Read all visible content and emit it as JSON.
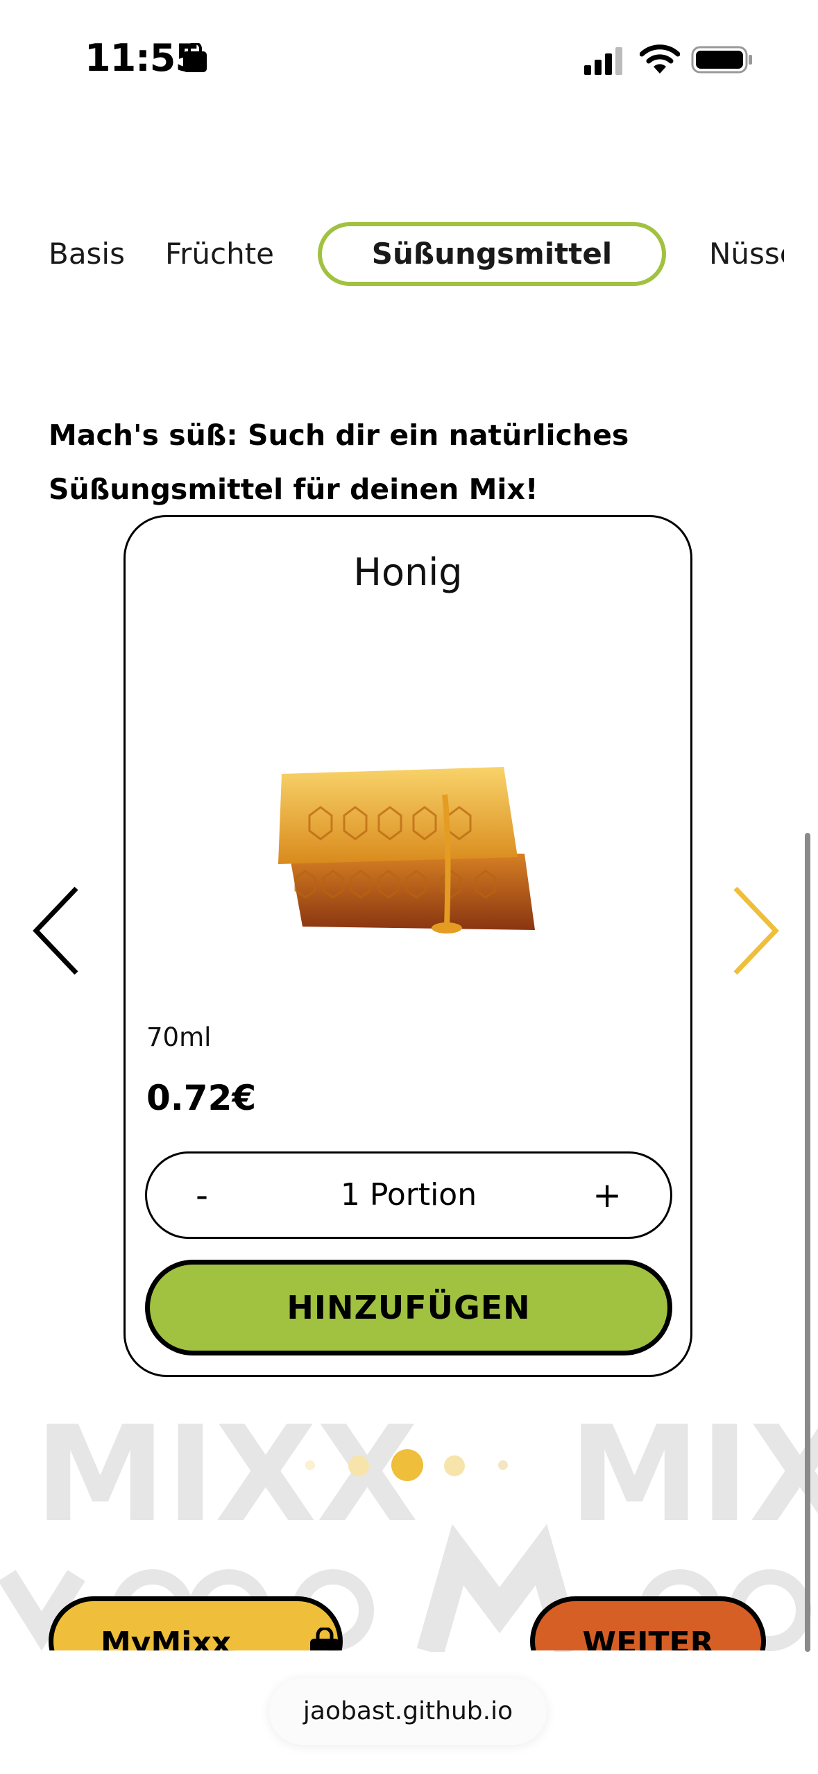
{
  "status_bar": {
    "time": "11:55",
    "icons": [
      "shopping-bag-icon",
      "cellular-signal-icon",
      "wifi-icon",
      "battery-icon"
    ]
  },
  "tabs": [
    {
      "label": "Basis",
      "active": false
    },
    {
      "label": "Früchte",
      "active": false
    },
    {
      "label": "Süßungsmittel",
      "active": true
    },
    {
      "label": "Nüsse",
      "active": false
    }
  ],
  "headline": "Mach's süß: Such dir ein natürliches Süßungsmittel für deinen Mix!",
  "product": {
    "name": "Honig",
    "size": "70ml",
    "price": "0.72€",
    "quantity_label": "1 Portion",
    "minus_label": "-",
    "plus_label": "+",
    "add_label": "HINZUFÜGEN",
    "image": "honeycomb-image"
  },
  "carousel": {
    "prev_icon": "chevron-left-icon",
    "next_icon": "chevron-right-icon",
    "page_count": 5,
    "active_index": 2
  },
  "watermark_text": "MIXX",
  "bottom": {
    "mymixx_label": "MyMixx",
    "weiter_label": "WEITER"
  },
  "browser": {
    "url": "jaobast.github.io"
  },
  "colors": {
    "accent_green": "#a1c140",
    "accent_yellow": "#efbe3a",
    "accent_orange": "#d65f26",
    "dot_active": "#efbe3a"
  }
}
